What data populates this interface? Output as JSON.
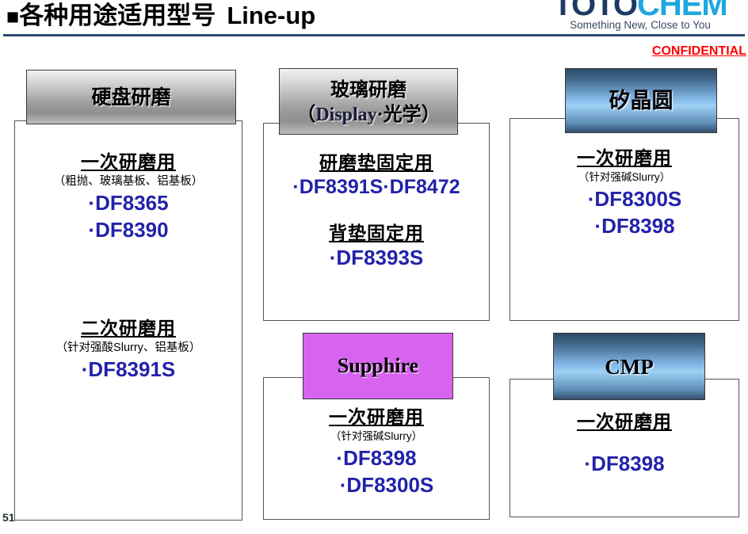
{
  "header": {
    "bullet": "■",
    "title_cjk": "各种用途适用型号",
    "title_latin": "Line-up",
    "logo_primary": "TOTO",
    "logo_secondary": "CHEM",
    "logo_tagline": "Something New, Close to You",
    "confidential": "CONFIDENTIAL",
    "rule_color": "#2e4a74",
    "confidential_color": "#ff0000"
  },
  "footer": {
    "page_number": "51"
  },
  "colors": {
    "model_blue": "#2222aa",
    "cap_violet": "#d764ef",
    "cap_blue_light": "#9ed0f5",
    "cap_blue_dark": "#2c4a66"
  },
  "cards": [
    {
      "id": "hdd-polishing",
      "cap_style": "grey",
      "cap_label": "硬盘研磨",
      "groups": [
        {
          "heading": "一次研磨用",
          "note": "（粗抛、玻璃基板、铝基板）",
          "models": [
            "·DF8365",
            "·DF8390"
          ]
        },
        {
          "heading": "二次研磨用",
          "note": "（针对强酸Slurry、铝基板）",
          "models": [
            "·DF8391S"
          ]
        }
      ]
    },
    {
      "id": "glass-polishing",
      "cap_style": "grey",
      "cap_label_line1": "玻璃研磨",
      "cap_label_line2_prefix": "（",
      "cap_label_line2_en": "Display",
      "cap_label_line2_suffix": "·光学）",
      "groups": [
        {
          "heading": "研磨垫固定用",
          "note": "",
          "models": [
            "·DF8391S·DF8472"
          ]
        },
        {
          "heading": "背垫固定用",
          "note": "",
          "models": [
            "·DF8393S"
          ]
        }
      ]
    },
    {
      "id": "silicon-wafer",
      "cap_style": "blue",
      "cap_label": "矽晶圆",
      "groups": [
        {
          "heading": "一次研磨用",
          "note": "（针对强碱Slurry）",
          "models": [
            "·DF8300S",
            "·DF8398"
          ]
        }
      ]
    },
    {
      "id": "sapphire",
      "cap_style": "violet",
      "cap_label": "Supphire",
      "groups": [
        {
          "heading": "一次研磨用",
          "note": "（针对强碱Slurry）",
          "models": [
            "·DF8398",
            "·DF8300S"
          ]
        }
      ]
    },
    {
      "id": "cmp",
      "cap_style": "blue",
      "cap_label": "CMP",
      "groups": [
        {
          "heading": "一次研磨用",
          "note": "",
          "models": [
            "·DF8398"
          ]
        }
      ]
    }
  ]
}
